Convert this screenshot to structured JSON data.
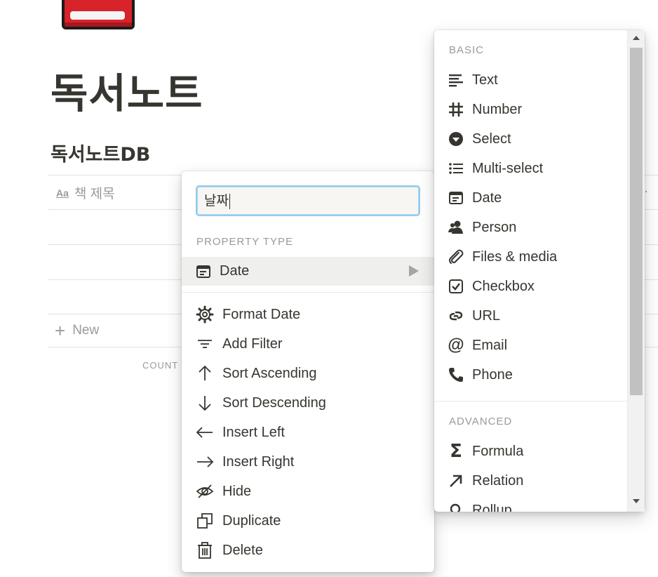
{
  "page": {
    "title": "독서노트",
    "database_title": "독서노트DB",
    "column_header": "책 제목",
    "new_label": "New",
    "count_label": "COUNT"
  },
  "property_menu": {
    "name_value": "날짜",
    "section_label": "PROPERTY TYPE",
    "current_type": "Date",
    "actions": [
      {
        "label": "Format Date",
        "icon": "gear-icon"
      },
      {
        "label": "Add Filter",
        "icon": "filter-icon"
      },
      {
        "label": "Sort Ascending",
        "icon": "arrow-up-icon"
      },
      {
        "label": "Sort Descending",
        "icon": "arrow-down-icon"
      },
      {
        "label": "Insert Left",
        "icon": "arrow-left-icon"
      },
      {
        "label": "Insert Right",
        "icon": "arrow-right-icon"
      },
      {
        "label": "Hide",
        "icon": "eye-slash-icon"
      },
      {
        "label": "Duplicate",
        "icon": "duplicate-icon"
      },
      {
        "label": "Delete",
        "icon": "trash-icon"
      }
    ]
  },
  "type_menu": {
    "basic_label": "BASIC",
    "basic": [
      {
        "label": "Text",
        "icon": "text-lines-icon"
      },
      {
        "label": "Number",
        "icon": "hash-icon"
      },
      {
        "label": "Select",
        "icon": "select-icon"
      },
      {
        "label": "Multi-select",
        "icon": "list-icon"
      },
      {
        "label": "Date",
        "icon": "calendar-icon"
      },
      {
        "label": "Person",
        "icon": "person-icon"
      },
      {
        "label": "Files & media",
        "icon": "paperclip-icon"
      },
      {
        "label": "Checkbox",
        "icon": "checkbox-icon"
      },
      {
        "label": "URL",
        "icon": "link-icon"
      },
      {
        "label": "Email",
        "icon": "at-icon"
      },
      {
        "label": "Phone",
        "icon": "phone-icon"
      }
    ],
    "advanced_label": "ADVANCED",
    "advanced": [
      {
        "label": "Formula",
        "icon": "sigma-icon"
      },
      {
        "label": "Relation",
        "icon": "arrow-up-right-icon"
      },
      {
        "label": "Rollup",
        "icon": "search-icon"
      }
    ]
  },
  "colors": {
    "book_red": "#d8232a",
    "text": "#37352f",
    "muted": "#9b9a97",
    "focus": "#94cbe9",
    "hover_bg": "#efefee"
  }
}
